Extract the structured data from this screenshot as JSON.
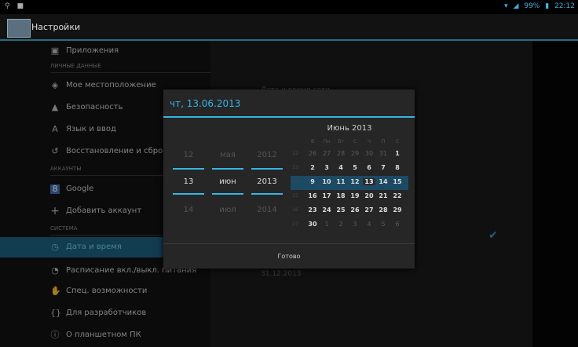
{
  "statusbar": {
    "battery": "99%",
    "time": "22:12"
  },
  "actionbar": {
    "title": "Настройки"
  },
  "settings": {
    "items_top": [
      {
        "label": "Приложения",
        "icon": "apps-icon"
      }
    ],
    "section_personal": "ЛИЧНЫЕ ДАННЫЕ",
    "items_personal": [
      {
        "label": "Мое местоположение",
        "icon": "location-icon"
      },
      {
        "label": "Безопасность",
        "icon": "lock-icon"
      },
      {
        "label": "Язык и ввод",
        "icon": "language-icon"
      },
      {
        "label": "Восстановление и сброс",
        "icon": "restore-icon"
      }
    ],
    "section_accounts": "АККАУНТЫ",
    "items_accounts": [
      {
        "label": "Google",
        "icon": "google-icon"
      },
      {
        "label": "Добавить аккаунт",
        "icon": "plus-icon"
      }
    ],
    "section_system": "СИСТЕМА",
    "items_system": [
      {
        "label": "Дата и время",
        "icon": "clock-icon",
        "selected": true
      },
      {
        "label": "Расписание вкл./выкл. питания",
        "icon": "power-schedule-icon"
      },
      {
        "label": "Спец. возможности",
        "icon": "accessibility-icon"
      },
      {
        "label": "Для разработчиков",
        "icon": "developer-icon"
      },
      {
        "label": "О планшетном ПК",
        "icon": "info-icon"
      }
    ]
  },
  "rightpane": {
    "network_time_label": "Дата и время сети",
    "date_value": "31.12.2013"
  },
  "dialog": {
    "title": "чт, 13.06.2013",
    "spinner_day": {
      "prev": "12",
      "cur": "13",
      "next": "14"
    },
    "spinner_month": {
      "prev": "мая",
      "cur": "июн",
      "next": "июл"
    },
    "spinner_year": {
      "prev": "2012",
      "cur": "2013",
      "next": "2014"
    },
    "calendar": {
      "month_title": "Июнь 2013",
      "weekdays": [
        "В",
        "Пн",
        "Вт",
        "С",
        "Ч",
        "П",
        "С"
      ],
      "weeks": [
        {
          "wn": "22",
          "days": [
            "26",
            "27",
            "28",
            "29",
            "30",
            "31",
            "1"
          ],
          "dim": [
            true,
            true,
            true,
            true,
            true,
            true,
            false
          ]
        },
        {
          "wn": "23",
          "days": [
            "2",
            "3",
            "4",
            "5",
            "6",
            "7",
            "8"
          ],
          "dim": [
            false,
            false,
            false,
            false,
            false,
            false,
            false
          ]
        },
        {
          "wn": "24",
          "days": [
            "9",
            "10",
            "11",
            "12",
            "13",
            "14",
            "15"
          ],
          "dim": [
            false,
            false,
            false,
            false,
            false,
            false,
            false
          ],
          "highlight": true
        },
        {
          "wn": "25",
          "days": [
            "16",
            "17",
            "18",
            "19",
            "20",
            "21",
            "22"
          ],
          "dim": [
            false,
            false,
            false,
            false,
            false,
            false,
            false
          ]
        },
        {
          "wn": "26",
          "days": [
            "23",
            "24",
            "25",
            "26",
            "27",
            "28",
            "29"
          ],
          "dim": [
            false,
            false,
            false,
            false,
            false,
            false,
            false
          ]
        },
        {
          "wn": "27",
          "days": [
            "30",
            "1",
            "2",
            "3",
            "4",
            "5",
            "6"
          ],
          "dim": [
            false,
            true,
            true,
            true,
            true,
            true,
            true
          ]
        }
      ],
      "selected_day": "13"
    },
    "done_label": "Готово"
  }
}
